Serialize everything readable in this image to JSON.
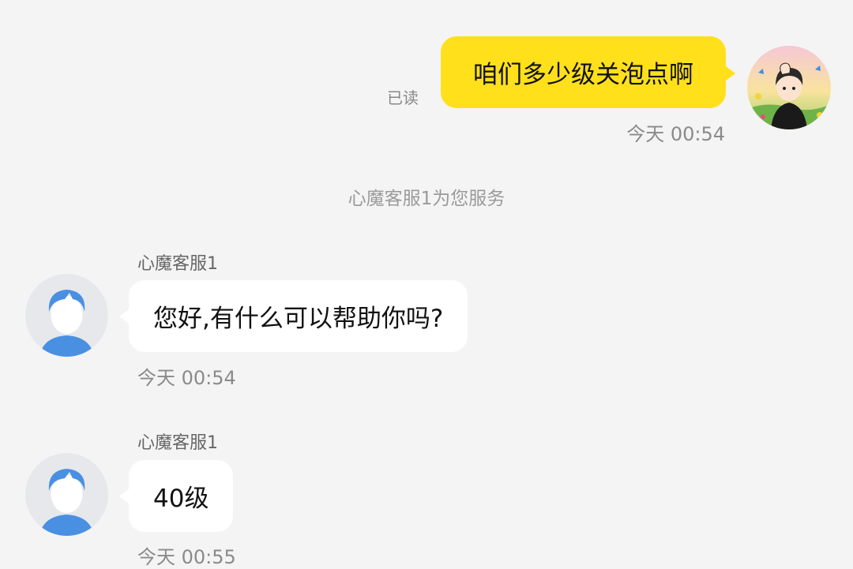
{
  "outgoing": {
    "text": "咱们多少级关泡点啊",
    "read_status": "已读",
    "time": "今天 00:54",
    "bubble_color": "#ffe01b"
  },
  "system_notice": "心魔客服1为您服务",
  "incoming": [
    {
      "sender": "心魔客服1",
      "text": "您好,有什么可以帮助你吗?",
      "time": "今天 00:54"
    },
    {
      "sender": "心魔客服1",
      "text": "40级",
      "time": "今天 00:55"
    }
  ],
  "icons": {
    "my_avatar": "cartoon-user-avatar-icon",
    "agent_avatar": "default-person-avatar-icon"
  },
  "colors": {
    "background": "#f4f4f4",
    "incoming_bubble": "#ffffff",
    "agent_avatar_accent": "#4a90e2"
  }
}
